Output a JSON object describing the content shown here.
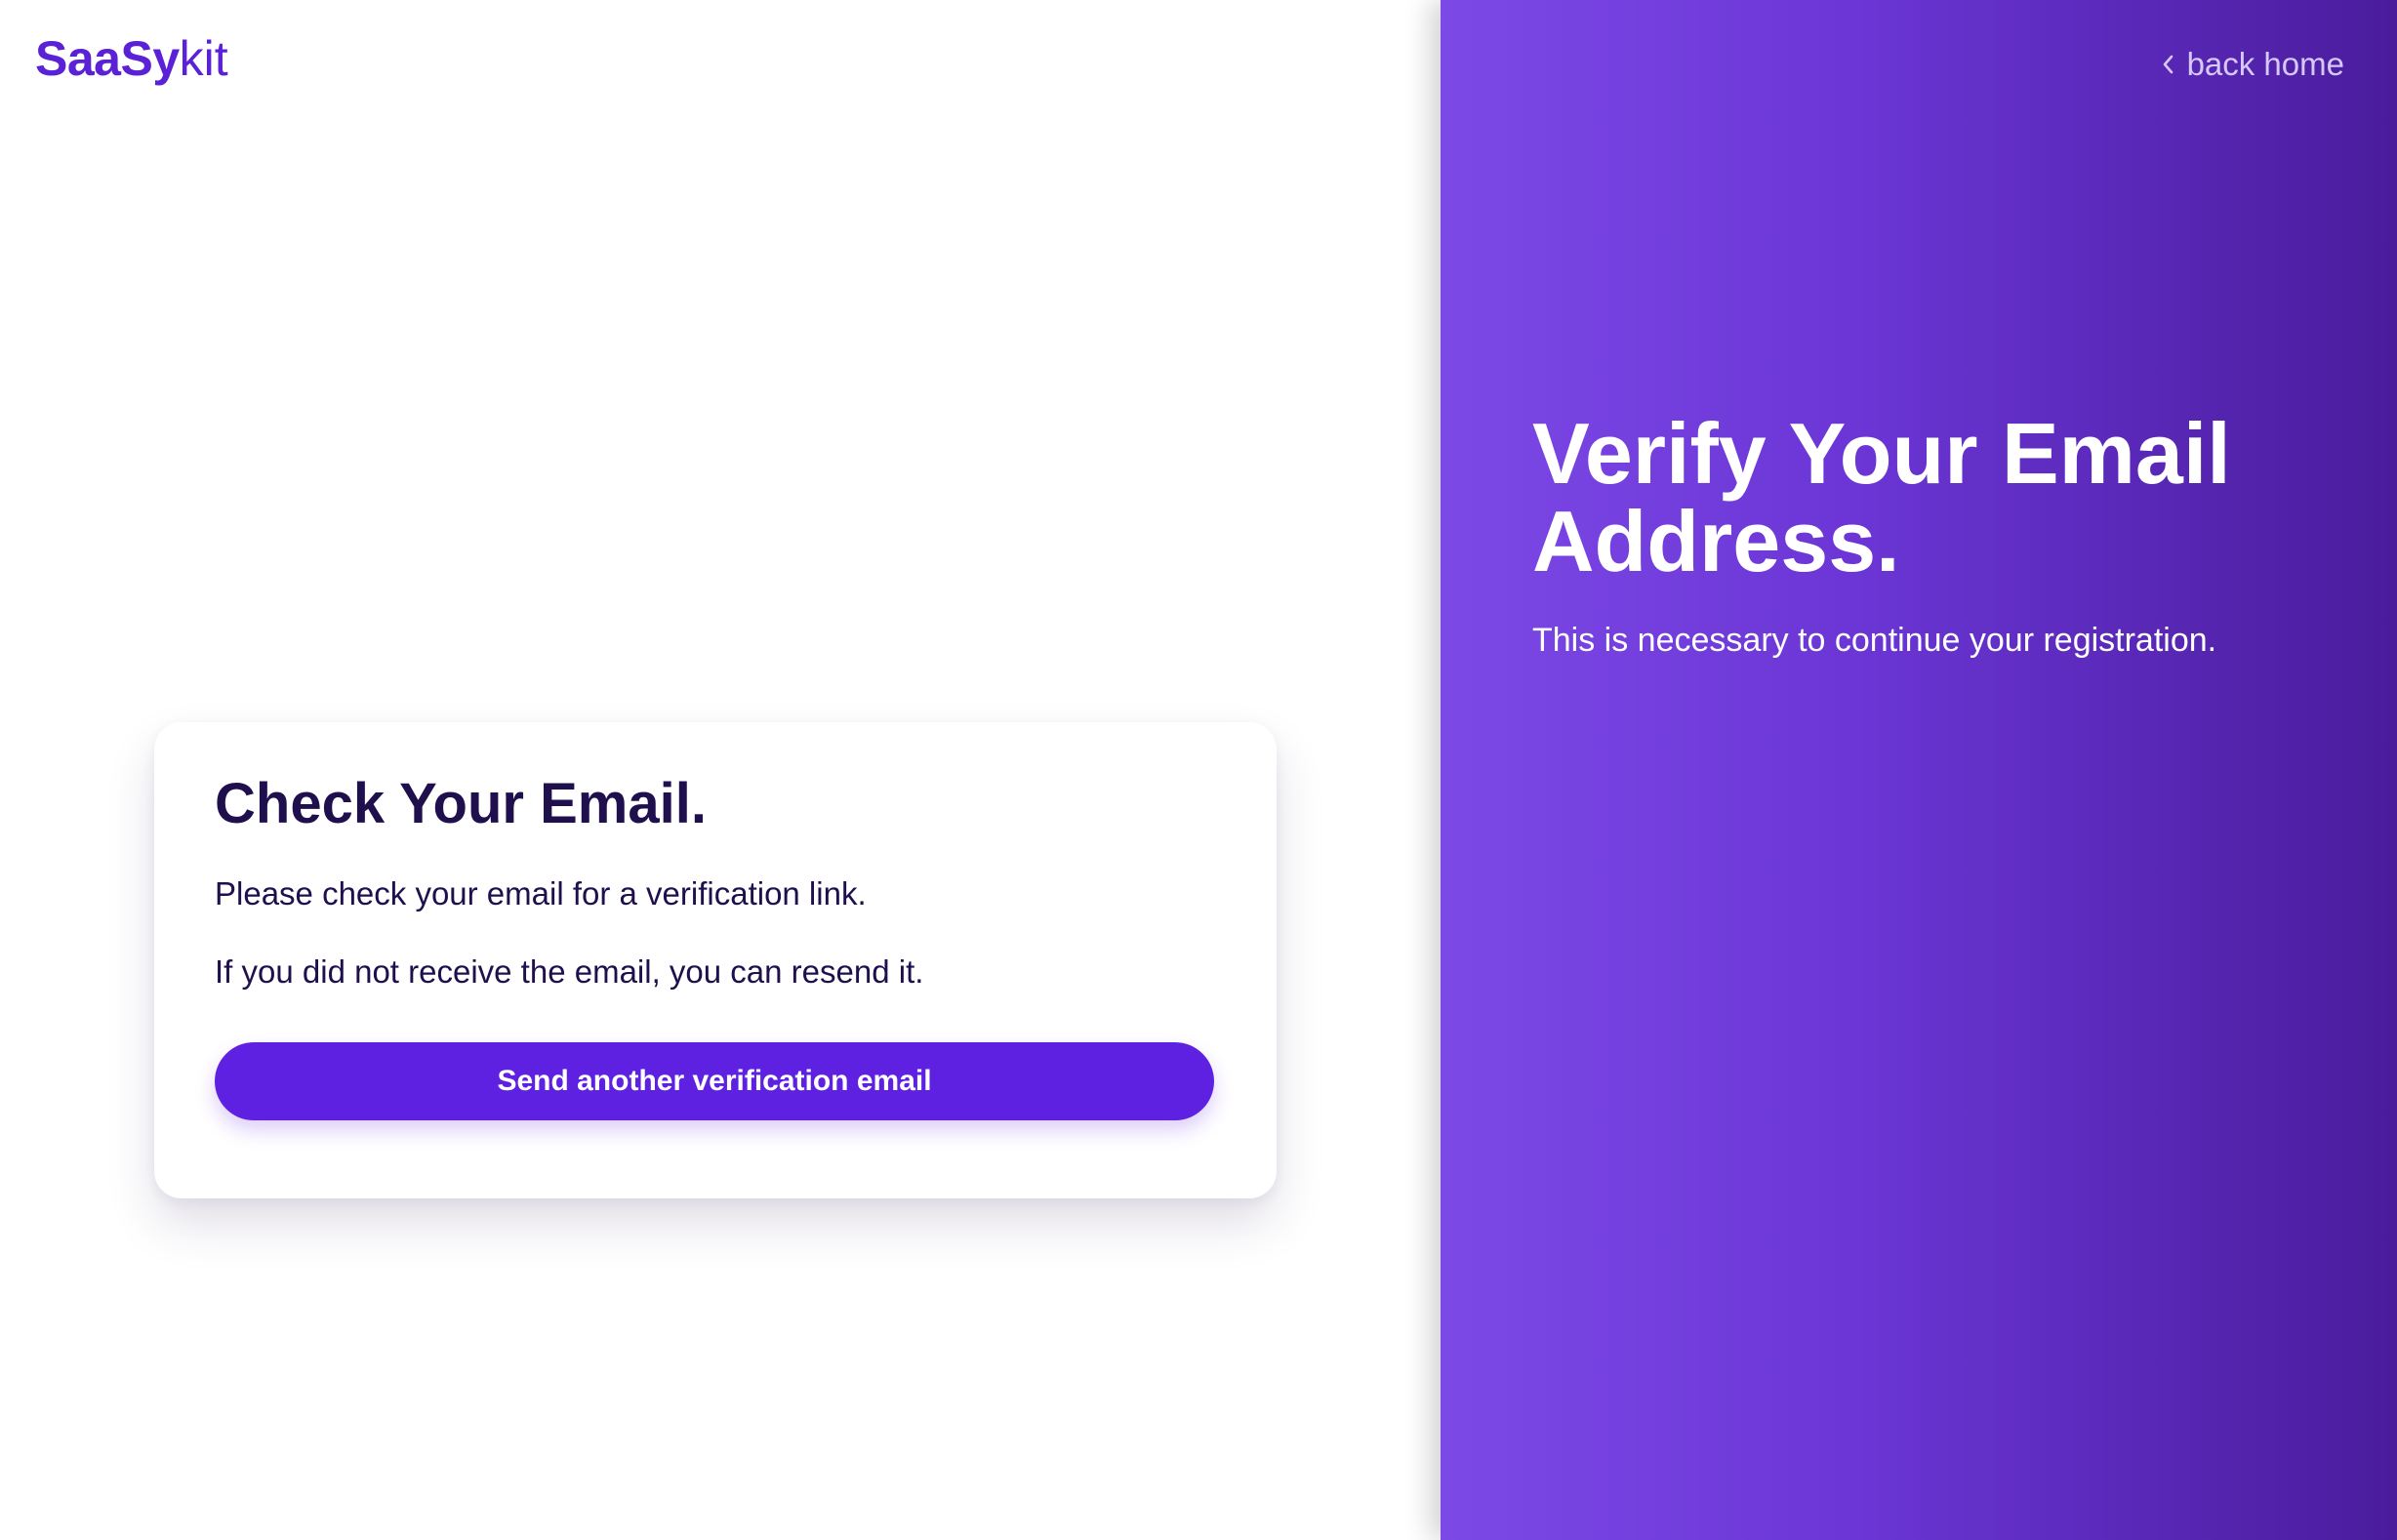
{
  "logo": {
    "bold": "SaaSy",
    "light": "kit"
  },
  "card": {
    "title": "Check Your Email.",
    "paragraph_1": "Please check your email for a verification link.",
    "paragraph_2": "If you did not receive the email, you can resend it.",
    "button_label": "Send another verification email"
  },
  "side_panel": {
    "back_label": "back home",
    "back_icon": "chevron-left-icon",
    "title": "Verify Your Email Address.",
    "subtitle": "This is necessary to continue your registration."
  },
  "colors": {
    "brand": "#5b21d6",
    "button": "#5e21e2",
    "heading_text": "#1f0f4d",
    "panel_gradient_start": "#7c48e6",
    "panel_gradient_end": "#4a1c9c"
  }
}
